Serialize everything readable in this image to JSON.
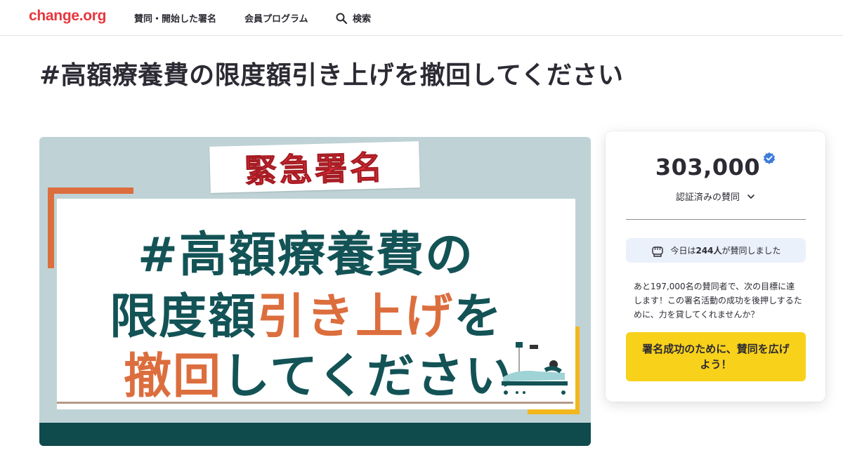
{
  "header": {
    "logo": "change.org",
    "nav": {
      "supported": "賛同・開始した署名",
      "membership": "会員プログラム",
      "search": "検索"
    }
  },
  "petition": {
    "title": "#高額療養費の限度額引き上げを撤回してください"
  },
  "hero_image": {
    "banner": "緊急署名",
    "line1": "#高額療養費の",
    "line2_dark_a": "限度額",
    "line2_orange": "引き上げ",
    "line2_dark_b": "を",
    "line3_orange": "撤回",
    "line3_dark": "してください",
    "colors": {
      "teal": "#135356",
      "orange": "#dc6e3e",
      "red": "#e3303a",
      "yellow": "#f2b71c"
    }
  },
  "sign_box": {
    "count": "303,000",
    "verified_label": "認証済みの賛同",
    "today_prefix": "今日は",
    "today_count": "244人",
    "today_suffix": "が賛同しました",
    "info": "あと197,000名の賛同者で、次の目標に達します！この署名活動の成功を後押しするために、力を貸してくれませんか？",
    "cta": "署名成功のために、賛同を広げよう！",
    "colors": {
      "cta_bg": "#f8d11b",
      "verified_blue": "#3d7bd9",
      "pill_bg": "#eaf1fb"
    }
  }
}
